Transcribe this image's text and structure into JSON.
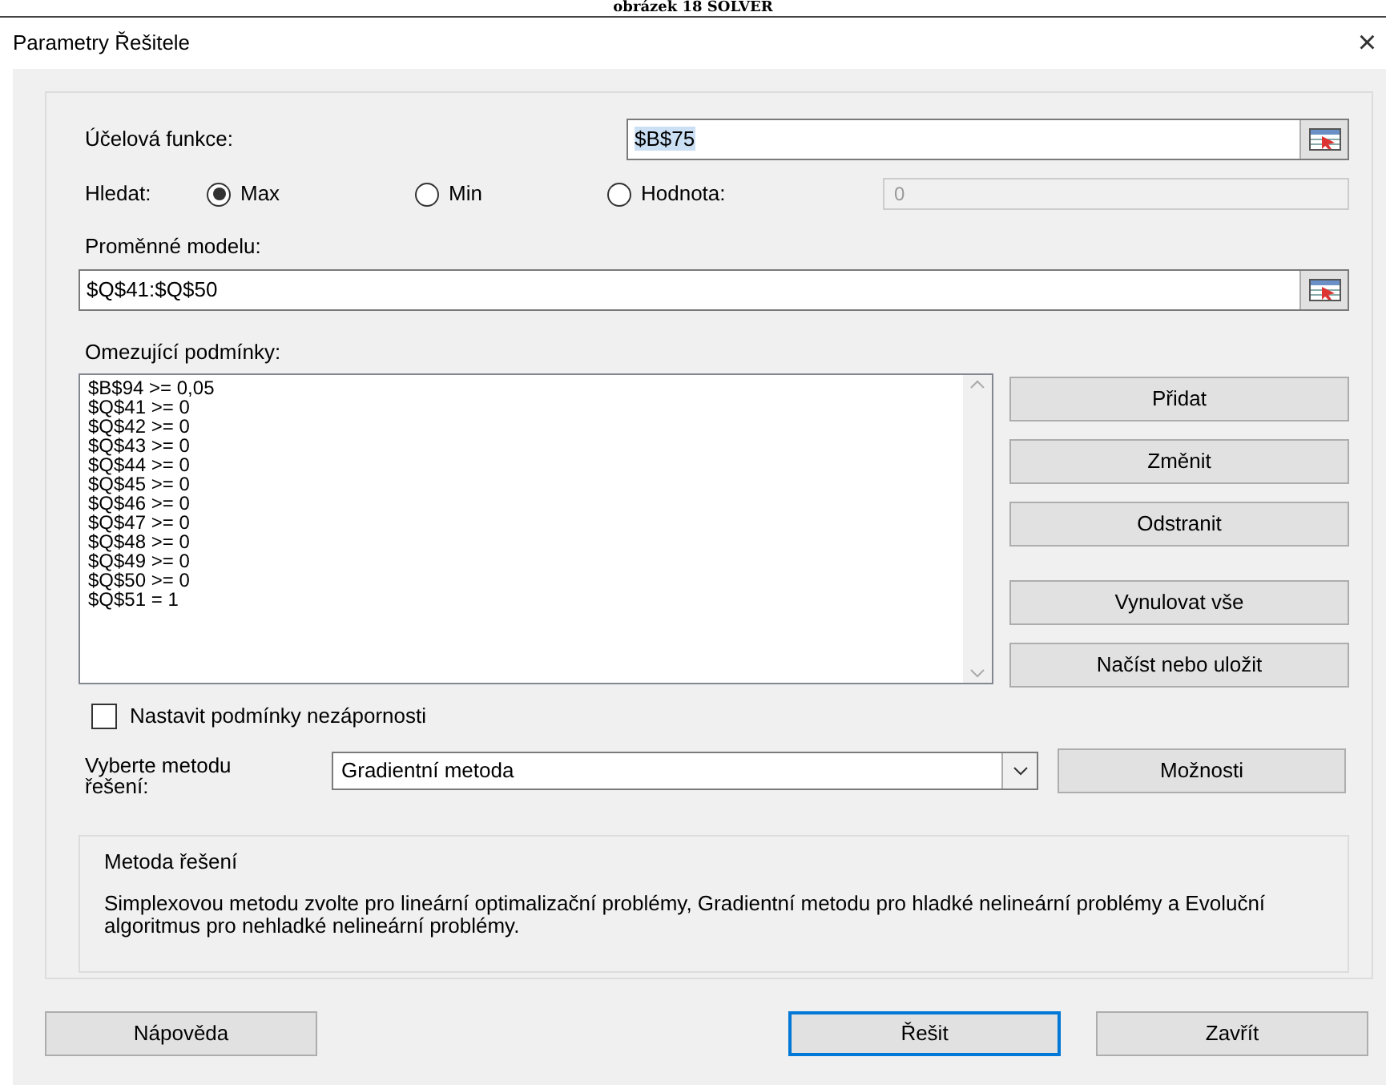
{
  "caption": "obrázek 18 SOLVER",
  "window": {
    "title": "Parametry Řešitele",
    "close": "×"
  },
  "objective": {
    "label": "Účelová funkce:",
    "value": "$B$75"
  },
  "goal": {
    "label": "Hledat:",
    "options": [
      {
        "label": "Max",
        "selected": true
      },
      {
        "label": "Min",
        "selected": false
      },
      {
        "label": "Hodnota:",
        "selected": false
      }
    ],
    "value_field": {
      "value": "0",
      "disabled": true
    }
  },
  "variables": {
    "label": "Proměnné modelu:",
    "value": "$Q$41:$Q$50"
  },
  "constraints": {
    "label": "Omezující podmínky:",
    "items": [
      "$B$94 >= 0,05",
      "$Q$41 >= 0",
      "$Q$42 >= 0",
      "$Q$43 >= 0",
      "$Q$44 >= 0",
      "$Q$45 >= 0",
      "$Q$46 >= 0",
      "$Q$47 >= 0",
      "$Q$48 >= 0",
      "$Q$49 >= 0",
      "$Q$50 >= 0",
      "$Q$51 = 1"
    ],
    "buttons": [
      "Přidat",
      "Změnit",
      "Odstranit",
      "Vynulovat vše",
      "Načíst nebo uložit"
    ]
  },
  "nonnegative": {
    "label": "Nastavit podmínky nezápornosti",
    "checked": false
  },
  "method": {
    "label": "Vyberte metodu řešení:",
    "value": "Gradientní metoda",
    "options_button": "Možnosti"
  },
  "method_info": {
    "title": "Metoda řešení",
    "text": "Simplexovou metodu zvolte pro lineární optimalizační problémy, Gradientní metodu pro hladké nelineární problémy a Evoluční algoritmus pro nehladké nelineární problémy."
  },
  "footer": [
    {
      "label": "Nápověda",
      "default": false
    },
    {
      "label": "Řešit",
      "default": true
    },
    {
      "label": "Zavřít",
      "default": false
    }
  ]
}
